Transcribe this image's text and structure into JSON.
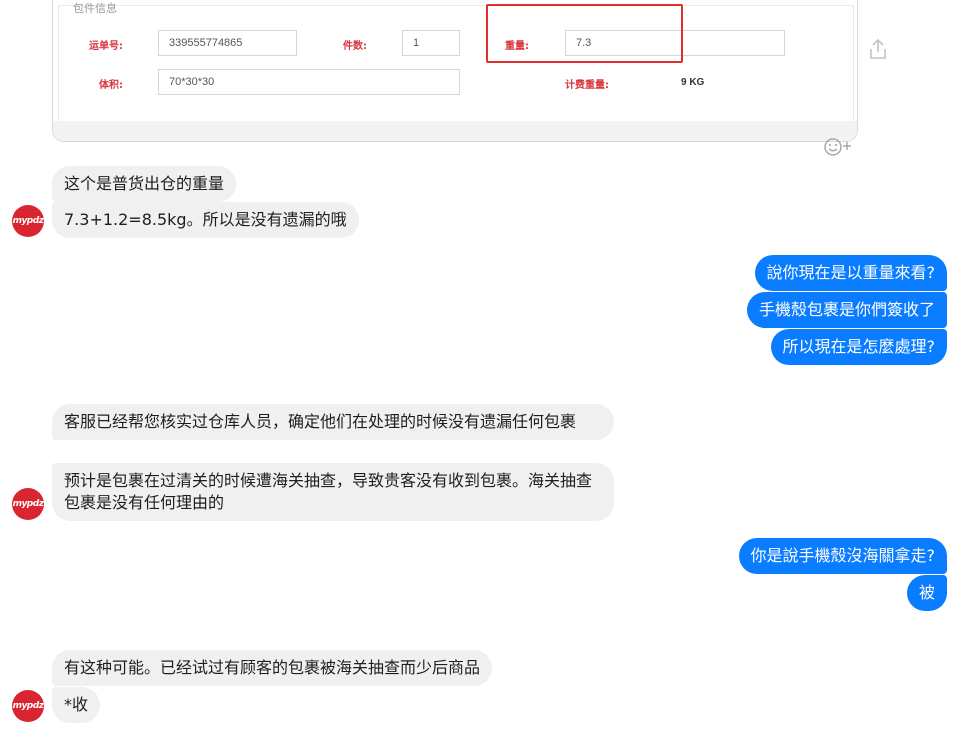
{
  "shared_card": {
    "form_heading": "包件信息",
    "fields": {
      "tracking_label": "运单号:",
      "tracking_value": "339555774865",
      "pieces_label": "件数:",
      "pieces_value": "1",
      "weight_label": "重量:",
      "weight_value": "7.3",
      "volume_label": "体积:",
      "volume_value": "70*30*30",
      "charge_weight_label": "计费重量:",
      "charge_weight_value": "9 KG"
    },
    "highlight_color": "#e0302e"
  },
  "avatar": {
    "text": "mypdz",
    "color": "#d9252f"
  },
  "messages": [
    {
      "id": "m1",
      "side": "incoming",
      "text": "这个是普货出仓的重量"
    },
    {
      "id": "m2",
      "side": "incoming",
      "text": "7.3+1.2=8.5kg。所以是没有遗漏的哦"
    },
    {
      "id": "m3",
      "side": "outgoing",
      "text": "說你現在是以重量來看?"
    },
    {
      "id": "m4",
      "side": "outgoing",
      "text": "手機殼包裹是你們簽收了"
    },
    {
      "id": "m5",
      "side": "outgoing",
      "text": "所以現在是怎麼處理?"
    },
    {
      "id": "m6",
      "side": "incoming",
      "text": "客服已经帮您核实过仓库人员，确定他们在处理的时候没有遗漏任何包裹"
    },
    {
      "id": "m7",
      "side": "incoming",
      "text": "预计是包裹在过清关的时候遭海关抽查，导致贵客没有收到包裹。海关抽查包裹是没有任何理由的"
    },
    {
      "id": "m8",
      "side": "outgoing",
      "text": "你是說手機殼沒海關拿走?"
    },
    {
      "id": "m9",
      "side": "outgoing",
      "text": "被"
    },
    {
      "id": "m10",
      "side": "incoming",
      "text": "有这种可能。已经试过有顾客的包裹被海关抽查而少后商品"
    },
    {
      "id": "m11",
      "side": "incoming",
      "text": "*收"
    }
  ],
  "colors": {
    "outgoing_bubble": "#0a7cff",
    "incoming_bubble": "#f0f0f0"
  },
  "icons": {
    "share": "share-icon",
    "reaction": "add-reaction-icon"
  }
}
